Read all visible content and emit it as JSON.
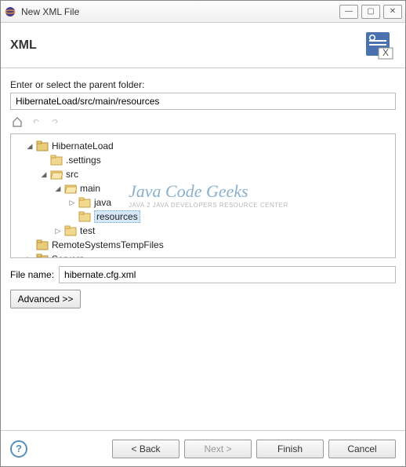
{
  "window": {
    "title": "New XML File"
  },
  "banner": {
    "heading": "XML"
  },
  "parent": {
    "label": "Enter or select the parent folder:",
    "value": "HibernateLoad/src/main/resources"
  },
  "tree": {
    "n0": "HibernateLoad",
    "n1": ".settings",
    "n2": "src",
    "n3": "main",
    "n4": "java",
    "n5": "resources",
    "n6": "test",
    "n7": "RemoteSystemsTempFiles",
    "n8": "Servers"
  },
  "file": {
    "label": "File name:",
    "value": "hibernate.cfg.xml"
  },
  "buttons": {
    "advanced": "Advanced >>",
    "back": "< Back",
    "next": "Next >",
    "finish": "Finish",
    "cancel": "Cancel"
  },
  "watermark": {
    "big": "Java Code Geeks",
    "small": "JAVA 2 JAVA DEVELOPERS RESOURCE CENTER"
  }
}
